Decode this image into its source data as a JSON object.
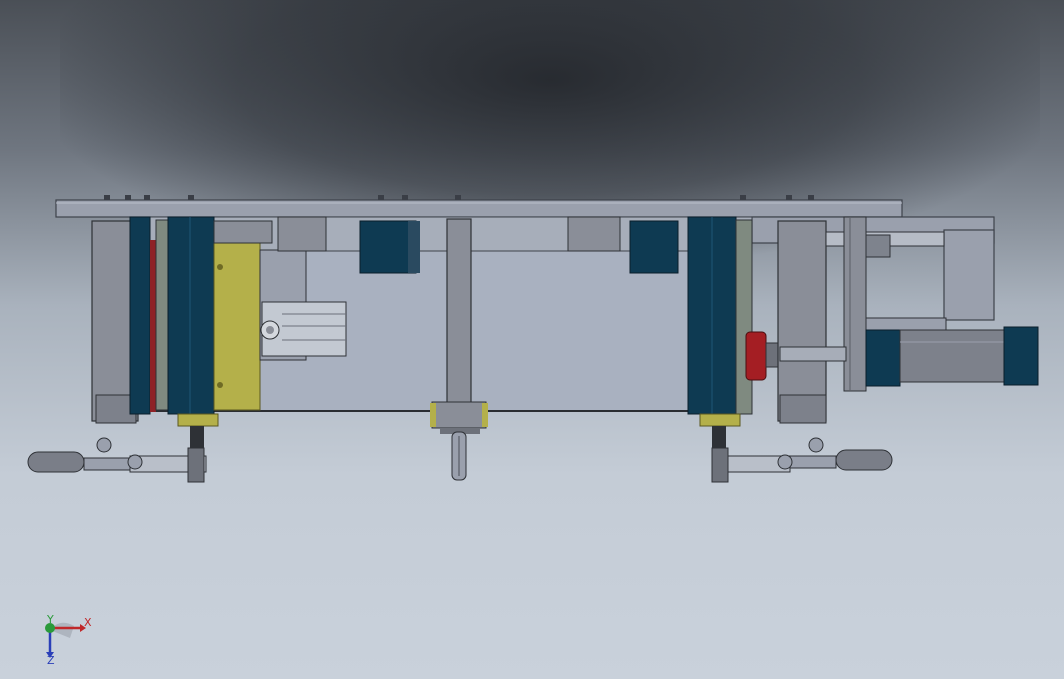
{
  "viewport": {
    "background_top": "#4a4f56",
    "background_bottom": "#c9d1db"
  },
  "model": {
    "frame_color": "#8a8e98",
    "panel_blue": "#0e3a52",
    "accent_yellow": "#b4b04a",
    "accent_red": "#8e2226",
    "plate_color": "#9aa0ad"
  },
  "triad": {
    "x_label": "X",
    "y_label": "Y",
    "z_label": "Z",
    "x_color": "#c0282a",
    "y_color": "#2a9a3a",
    "z_color": "#2a3fb8"
  }
}
